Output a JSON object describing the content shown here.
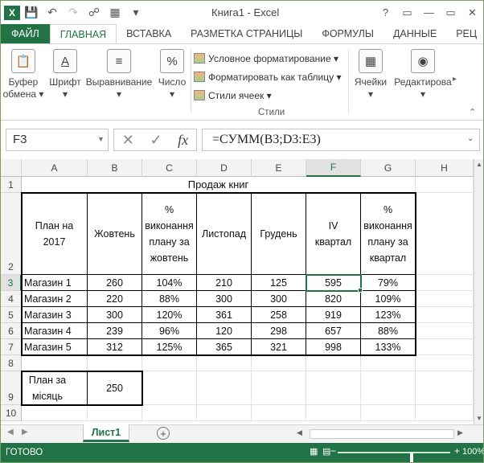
{
  "window": {
    "title": "Книга1 - Excel",
    "help": "?",
    "minimize": "—",
    "restore": "▭",
    "close": "✕"
  },
  "qat": [
    "save-icon",
    "undo-icon",
    "redo-icon",
    "print-preview-icon",
    "form-icon",
    "customize-icon"
  ],
  "tabs": [
    "ФАЙЛ",
    "ГЛАВНАЯ",
    "ВСТАВКА",
    "РАЗМЕТКА СТРАНИЦЫ",
    "ФОРМУЛЫ",
    "ДАННЫЕ",
    "РЕЦ"
  ],
  "ribbon": {
    "clipboard_label1": "Буфер",
    "clipboard_label2": "обмена ▾",
    "font_label": "Шрифт",
    "font_arrow": "▾",
    "align_label": "Выравнивание",
    "align_arrow": "▾",
    "number_label": "Число",
    "number_arrow": "▾",
    "cond_format": "Условное форматирование ▾",
    "format_table": "Форматировать как таблицу ▾",
    "cell_styles": "Стили ячеек ▾",
    "styles_caption": "Стили",
    "cells_label": "Ячейки",
    "cells_arrow": "▾",
    "editing_label": "Редактирова",
    "editing_arrow": "▾"
  },
  "formula_bar": {
    "name_box": "F3",
    "formula": "=СУММ(B3;D3:E3)",
    "cancel": "✕",
    "enter": "✓",
    "fx": "fx"
  },
  "columns": [
    "A",
    "B",
    "C",
    "D",
    "E",
    "F",
    "G",
    "H"
  ],
  "selected_column": "F",
  "rows": [
    "1",
    "2",
    "3",
    "4",
    "5",
    "6",
    "7",
    "8",
    "9",
    "10"
  ],
  "selected_row": "3",
  "sheet": {
    "title": "Продаж книг",
    "headers": [
      "План на 2017",
      "Жовтень",
      "% виконання плану за жовтень",
      "Листопад",
      "Грудень",
      "IV квартал",
      "% виконання плану за квартал"
    ],
    "data": [
      [
        "Магазин 1",
        "260",
        "104%",
        "210",
        "125",
        "595",
        "79%"
      ],
      [
        "Магазин 2",
        "220",
        "88%",
        "300",
        "300",
        "820",
        "109%"
      ],
      [
        "Магазин 3",
        "300",
        "120%",
        "361",
        "258",
        "919",
        "123%"
      ],
      [
        "Магазин 4",
        "239",
        "96%",
        "120",
        "298",
        "657",
        "88%"
      ],
      [
        "Магазин 5",
        "312",
        "125%",
        "365",
        "321",
        "998",
        "133%"
      ]
    ],
    "plan_label": "План за місяць",
    "plan_value": "250"
  },
  "sheet_tabs": {
    "active": "Лист1",
    "add": "+"
  },
  "status": {
    "text": "ГОТОВО",
    "zoom_minus": "−",
    "zoom_plus": "+",
    "zoom": "100%"
  }
}
